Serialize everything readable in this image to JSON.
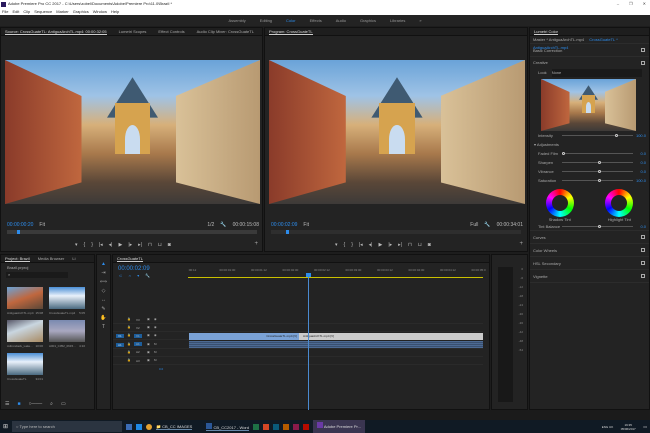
{
  "window": {
    "title": "Adobe Premiere Pro CC 2017 - C:\\Users\\zobel\\Documents\\Adobe\\Premiere Pro\\11.0\\Brazil *",
    "min": "–",
    "max": "❐",
    "close": "✕"
  },
  "menu": [
    "File",
    "Edit",
    "Clip",
    "Sequence",
    "Marker",
    "Graphics",
    "Window",
    "Help"
  ],
  "workspaces": [
    "Assembly",
    "Editing",
    "Color",
    "Effects",
    "Audio",
    "Graphics",
    "Libraries"
  ],
  "workspace_active": "Color",
  "source": {
    "tabs": [
      "Source: CrossGuateTL: AntiguaArchTL.mp4: 00:00:32:05",
      "Lumetri Scopes",
      "Effect Controls",
      "Audio Clip Mixer: CrossGuateTL"
    ],
    "timecode": "00:00:00:20",
    "fit": "Fit",
    "resolution": "1/2",
    "duration": "00:00:15:08"
  },
  "program": {
    "tab": "Program: CrossGuateTL",
    "timecode": "00:00:02:09",
    "fit": "Fit",
    "resolution": "Full",
    "duration": "00:00:34:01"
  },
  "lumetri": {
    "tab": "Lumetri Color",
    "master": "Master * AntiguaArchTL.mp4",
    "seq": "CrossGuateTL * AntiguaArchTL.mp4",
    "sections": {
      "basic": "Basic Correction",
      "creative": "Creative",
      "curves": "Curves",
      "wheels": "Color Wheels",
      "hsl": "HSL Secondary",
      "vignette": "Vignette"
    },
    "look_label": "Look",
    "look_value": "None",
    "intensity_label": "Intensity",
    "intensity": "100.0",
    "adjustments": "Adjustments",
    "sliders": [
      {
        "label": "Faded Film",
        "value": "0.0",
        "pct": 0
      },
      {
        "label": "Sharpen",
        "value": "0.0",
        "pct": 50
      },
      {
        "label": "Vibrance",
        "value": "0.0",
        "pct": 50
      },
      {
        "label": "Saturation",
        "value": "100.0",
        "pct": 50
      }
    ],
    "shadow_tint": "Shadow Tint",
    "highlight_tint": "Highlight Tint",
    "tint_balance_label": "Tint Balance",
    "tint_balance": "0.0"
  },
  "project": {
    "tabs": [
      "Project: Brazil",
      "Media Browser",
      "Li"
    ],
    "file": "Brazil.prproj",
    "items": [
      {
        "name": "AntiguaArchTL.mp4",
        "dur": "15:08"
      },
      {
        "name": "CrossGuateTL.mp4",
        "dur": "5:05"
      },
      {
        "name": "Adirondack_Lake...",
        "dur": "10:00"
      },
      {
        "name": "A001_C052_0615...",
        "dur": "4:10"
      },
      {
        "name": "CrossGuateTL",
        "dur": "34:01"
      }
    ]
  },
  "timeline": {
    "tab": "CrossGuateTL",
    "timecode": "00:00:02:09",
    "ruler": [
      ":00:12",
      "00:00:01:00",
      "00:00:01:12",
      "00:00:02:00",
      "00:00:02:12",
      "00:00:03:00",
      "00:00:03:12",
      "00:00:04:00",
      "00:00:04:12",
      "00:00:05:0"
    ],
    "tracks": [
      "V3",
      "V2",
      "V1",
      "A1",
      "A2",
      "A3"
    ],
    "src_v": "V1",
    "src_a": "A1",
    "master_val": "0.0",
    "clip1": "CrossGuateTL.mp4 [V]",
    "clip2": "AntiguaArchTL.mp4 [V]"
  },
  "meter_ticks": [
    "0",
    "-6",
    "-12",
    "-18",
    "-24",
    "-30",
    "-36",
    "-42",
    "-48",
    "-54"
  ],
  "taskbar": {
    "search": "Type here to search",
    "apps": [
      "CB_CC IMAGES",
      "CB_CC2017 - Word",
      "Adobe Premiere Pr..."
    ],
    "lang": "ENG UK",
    "time": "19:35",
    "date": "05/06/2017"
  }
}
